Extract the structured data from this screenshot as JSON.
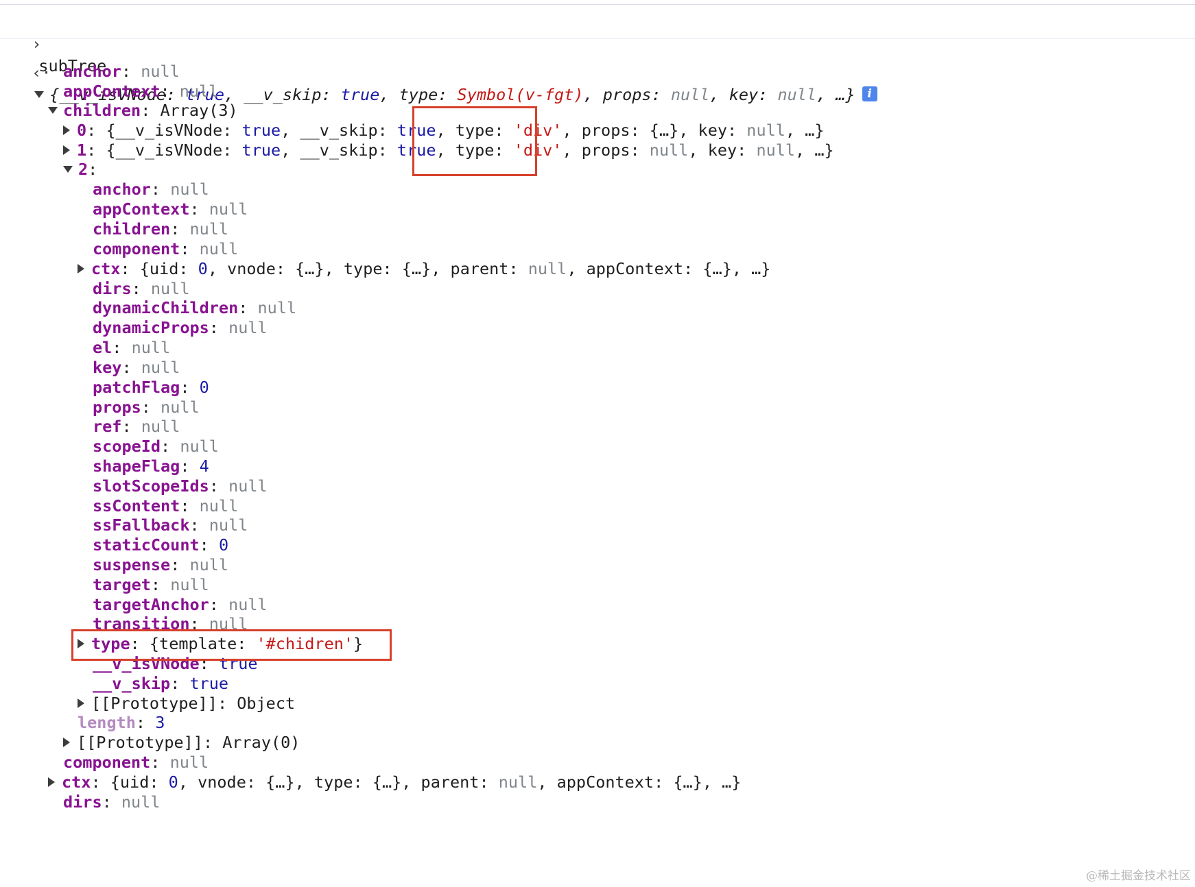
{
  "prompt": {
    "input": "subTree"
  },
  "root_preview": {
    "open": "{",
    "k1": "__v_isVNode",
    "v1": "true",
    "k2": "__v_skip",
    "v2": "true",
    "k3": "type",
    "v3": "Symbol(v-fgt)",
    "k4": "props",
    "v4": "null",
    "k5": "key",
    "v5": "null",
    "tail": "…}"
  },
  "lines": [
    {
      "key": "anchor",
      "val": "null",
      "vtype": "nul"
    },
    {
      "key": "appContext",
      "val": "null",
      "vtype": "nul"
    },
    {
      "key": "children",
      "val": "Array(3)",
      "vtype": "obj"
    },
    {
      "key": "0",
      "val": "{__v_isVNode: true, __v_skip: true, type: 'div', props: {…}, key: null, …}"
    },
    {
      "key": "1",
      "val": "{__v_isVNode: true, __v_skip: true, type: 'div', props: null, key: null, …}"
    },
    {
      "key": "2",
      "val": ""
    },
    {
      "key": "anchor",
      "val": "null",
      "vtype": "nul"
    },
    {
      "key": "appContext",
      "val": "null",
      "vtype": "nul"
    },
    {
      "key": "children",
      "val": "null",
      "vtype": "nul"
    },
    {
      "key": "component",
      "val": "null",
      "vtype": "nul"
    },
    {
      "key": "ctx",
      "val": "{uid: 0, vnode: {…}, type: {…}, parent: null, appContext: {…}, …}"
    },
    {
      "key": "dirs",
      "val": "null",
      "vtype": "nul"
    },
    {
      "key": "dynamicChildren",
      "val": "null",
      "vtype": "nul"
    },
    {
      "key": "dynamicProps",
      "val": "null",
      "vtype": "nul"
    },
    {
      "key": "el",
      "val": "null",
      "vtype": "nul"
    },
    {
      "key": "key",
      "val": "null",
      "vtype": "nul"
    },
    {
      "key": "patchFlag",
      "val": "0",
      "vtype": "num"
    },
    {
      "key": "props",
      "val": "null",
      "vtype": "nul"
    },
    {
      "key": "ref",
      "val": "null",
      "vtype": "nul"
    },
    {
      "key": "scopeId",
      "val": "null",
      "vtype": "nul"
    },
    {
      "key": "shapeFlag",
      "val": "4",
      "vtype": "num"
    },
    {
      "key": "slotScopeIds",
      "val": "null",
      "vtype": "nul"
    },
    {
      "key": "ssContent",
      "val": "null",
      "vtype": "nul"
    },
    {
      "key": "ssFallback",
      "val": "null",
      "vtype": "nul"
    },
    {
      "key": "staticCount",
      "val": "0",
      "vtype": "num"
    },
    {
      "key": "suspense",
      "val": "null",
      "vtype": "nul"
    },
    {
      "key": "target",
      "val": "null",
      "vtype": "nul"
    },
    {
      "key": "targetAnchor",
      "val": "null",
      "vtype": "nul"
    },
    {
      "key": "transition",
      "val": "null",
      "vtype": "nul"
    },
    {
      "key": "type",
      "val": "{template: '#chidren'}"
    },
    {
      "key": "__v_isVNode",
      "val": "true",
      "vtype": "bool"
    },
    {
      "key": "__v_skip",
      "val": "true",
      "vtype": "bool"
    },
    {
      "key": "[[Prototype]]",
      "val": "Object",
      "vtype": "obj"
    },
    {
      "key": "length",
      "val": "3",
      "vtype": "num"
    },
    {
      "key": "[[Prototype]]",
      "val": "Array(0)",
      "vtype": "obj"
    },
    {
      "key": "component",
      "val": "null",
      "vtype": "nul"
    },
    {
      "key": "ctx",
      "val": "{uid: 0, vnode: {…}, type: {…}, parent: null, appContext: {…}, …}"
    },
    {
      "key": "dirs",
      "val": "null",
      "vtype": "nul"
    }
  ],
  "parts": {
    "type_key": "type",
    "div_str": "'div'",
    "vnode_key": "__v_isVNode",
    "skip_key": "__v_skip",
    "true": "true",
    "props_key": "props",
    "key_key": "key",
    "null": "null",
    "obj_ellipsis": "{…}",
    "tail": "…}",
    "open": "{",
    "uid_key": "uid",
    "zero": "0",
    "vnode_k": "vnode",
    "parent_k": "parent",
    "appctx_k": "appContext",
    "template_k": "template",
    "template_v": "'#chidren'"
  },
  "watermark": "@稀土掘金技术社区"
}
